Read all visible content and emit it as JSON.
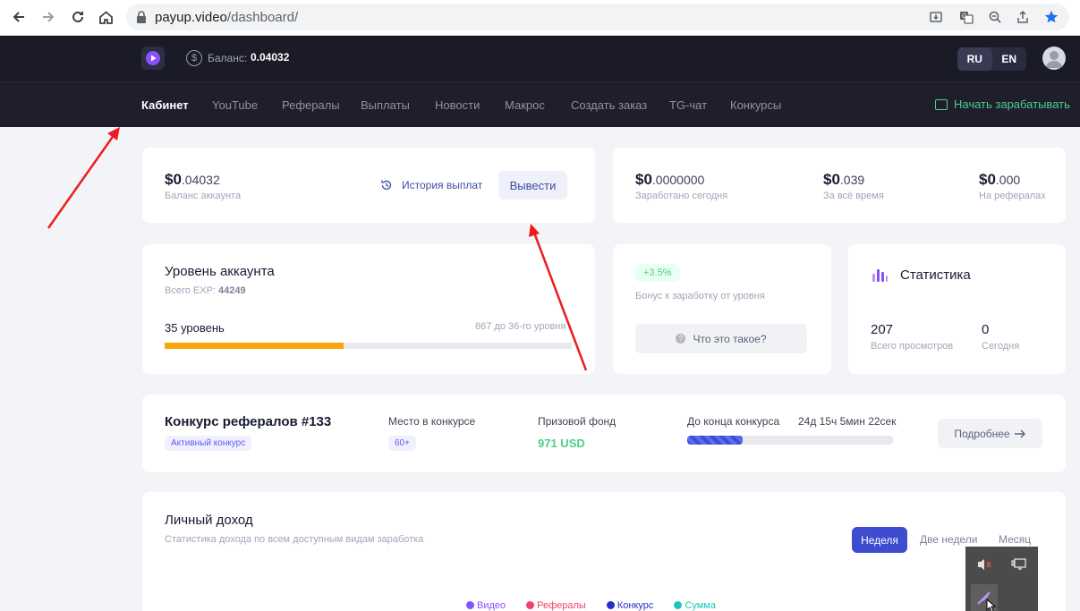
{
  "browser": {
    "url_host": "payup.video",
    "url_path": "/dashboard/"
  },
  "header": {
    "balance_label": "Баланс:",
    "balance_value": "0.04032",
    "lang_ru": "RU",
    "lang_en": "EN"
  },
  "nav": {
    "items": [
      "Кабинет",
      "YouTube",
      "Рефералы",
      "Выплаты",
      "Новости",
      "Макрос",
      "Создать заказ",
      "TG-чат",
      "Конкурсы"
    ],
    "start_earning": "Начать зарабатывать"
  },
  "balance_card": {
    "currency": "$0",
    "value": ".04032",
    "label": "Баланс аккаунта",
    "history_link": "История выплат",
    "withdraw_button": "Вывести"
  },
  "earnings_card": {
    "items": [
      {
        "currency": "$0",
        "value": ".0000000",
        "label": "Заработано сегодня"
      },
      {
        "currency": "$0",
        "value": ".039",
        "label": "За всё время"
      },
      {
        "currency": "$0",
        "value": ".000",
        "label": "На рефералах"
      }
    ]
  },
  "level_card": {
    "title": "Уровень аккаунта",
    "exp_label": "Всего EXP:",
    "exp_value": "44249",
    "level": "35 уровень",
    "to_next": "867 до 36-го уровня",
    "progress": 0.44
  },
  "bonus_card": {
    "badge": "+3.5%",
    "label": "Бонус к заработку от уровня",
    "help_button": "Что это такое?"
  },
  "stats_card": {
    "title": "Статистика",
    "views_value": "207",
    "views_label": "Всего просмотров",
    "today_value": "0",
    "today_label": "Сегодня"
  },
  "contest_card": {
    "title": "Конкурс рефералов #133",
    "badge": "Активный конкурс",
    "place_label": "Место в конкурсе",
    "place_value": "60+",
    "fund_label": "Призовой фонд",
    "fund_value": "971 USD",
    "end_label": "До конца конкурса",
    "end_value": "24д 15ч 5мин 22сек",
    "progress": 0.27,
    "more_button": "Подробнее"
  },
  "income_card": {
    "title": "Личный доход",
    "subtitle": "Статистика дохода по всем доступным видам заработка",
    "tabs": [
      "Неделя",
      "Две недели",
      "Месяц"
    ],
    "active_tab": "Неделя",
    "legend": [
      {
        "name": "Видео",
        "color": "#8950fc"
      },
      {
        "name": "Рефералы",
        "color": "#f1416c"
      },
      {
        "name": "Конкурс",
        "color": "#2a2fc4"
      },
      {
        "name": "Сумма",
        "color": "#1bc5bd"
      }
    ]
  },
  "colors": {
    "accent": "#3e4ccf",
    "success": "#50cd89",
    "warning": "#f7a70c",
    "dark_header": "#1b1b28"
  }
}
